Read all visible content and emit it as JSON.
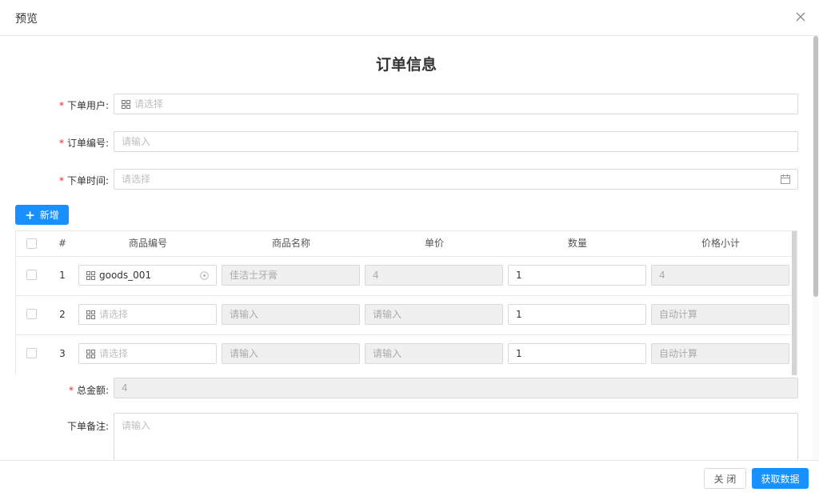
{
  "window": {
    "title": "预览"
  },
  "form": {
    "title": "订单信息",
    "user": {
      "label": "下单用户",
      "placeholder": "请选择"
    },
    "order_no": {
      "label": "订单编号",
      "placeholder": "请输入"
    },
    "order_time": {
      "label": "下单时间",
      "placeholder": "请选择"
    },
    "required_mark": "*",
    "colon": ":",
    "add_button": {
      "icon": "+",
      "label": "新增"
    },
    "total": {
      "label": "总金额",
      "value": "4"
    },
    "remark": {
      "label": "下单备注",
      "placeholder": "请输入"
    }
  },
  "table": {
    "columns": [
      "#",
      "商品编号",
      "商品名称",
      "单价",
      "数量",
      "价格小计"
    ],
    "rows": [
      {
        "index": "1",
        "goods_no": "goods_001",
        "goods_no_filled": true,
        "name": "佳洁士牙膏",
        "price": "4",
        "qty": "1",
        "subtotal": "4"
      },
      {
        "index": "2",
        "goods_no": "请选择",
        "goods_no_filled": false,
        "name": "请输入",
        "price": "请输入",
        "qty": "1",
        "subtotal": "自动计算"
      },
      {
        "index": "3",
        "goods_no": "请选择",
        "goods_no_filled": false,
        "name": "请输入",
        "price": "请输入",
        "qty": "1",
        "subtotal": "自动计算"
      }
    ]
  },
  "footer": {
    "close_label": "关 闭",
    "submit_label": "获取数据"
  },
  "colors": {
    "primary": "#1890ff",
    "required": "#f5222d",
    "disabled_bg": "#f0f0f0"
  },
  "icons": {
    "close": "close-icon",
    "grid": "grid-icon",
    "calendar": "calendar-icon",
    "clear": "clear-circle-icon",
    "plus": "plus-icon"
  }
}
